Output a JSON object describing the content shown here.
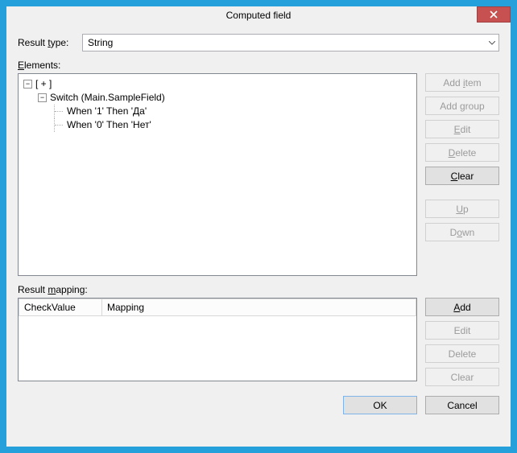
{
  "window": {
    "title": "Computed field"
  },
  "resultType": {
    "label_pre": "Result ",
    "label_u": "t",
    "label_post": "ype:",
    "value": "String"
  },
  "elements": {
    "label_u": "E",
    "label_post": "lements:",
    "tree": {
      "root": "[ + ]",
      "switch": "Switch (Main.SampleField)",
      "when1": "When '1' Then 'Да'",
      "when0": "When '0' Then 'Нет'"
    },
    "buttons": {
      "addItem_pre": "Add ",
      "addItem_u": "i",
      "addItem_post": "tem",
      "addGroup_pre": "Add ",
      "addGroup_u": "g",
      "addGroup_post": "roup",
      "edit_u": "E",
      "edit_post": "dit",
      "delete_u": "D",
      "delete_post": "elete",
      "clear_u": "C",
      "clear_post": "lear",
      "up_u": "U",
      "up_post": "p",
      "down_pre": "D",
      "down_u": "o",
      "down_post": "wn"
    }
  },
  "mapping": {
    "label_pre": "Result ",
    "label_u": "m",
    "label_post": "apping:",
    "columns": {
      "checkValue": "CheckValue",
      "mapping": "Mapping"
    },
    "buttons": {
      "add_u": "A",
      "add_post": "dd",
      "edit": "Edit",
      "delete": "Delete",
      "clear": "Clear"
    }
  },
  "footer": {
    "ok": "OK",
    "cancel": "Cancel"
  }
}
